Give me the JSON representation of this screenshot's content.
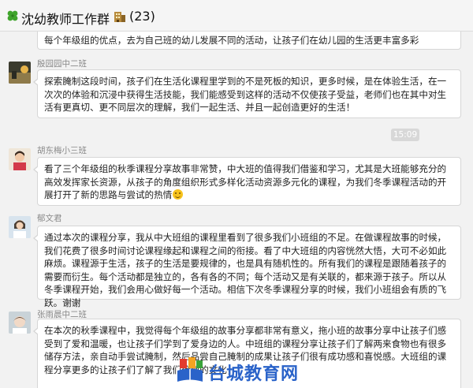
{
  "header": {
    "title": "沈幼教师工作群",
    "member_count": "(23)",
    "clover_icon": "four-leaf-clover-icon",
    "building_icon": "office-building-icon"
  },
  "messages": [
    {
      "sender": "",
      "text": "每个年级组的优点，去为自己班的幼儿发展不同的活动，让孩子们在幼儿园的生活更丰富多彩"
    },
    {
      "sender": "殷园园中二班",
      "text": "探索腌制这段时间，孩子们在生活化课程里学到的不是死板的知识，更多时候，是在体验生活，在一次次的体验和沉浸中获得生活技能，我们能感受到这样的活动不仅使孩子受益，老师们也在其中对生活有更真切、更不同层次的理解，我们一起生活、并且一起创造更好的生活！"
    },
    {
      "sender": "胡东梅小三班",
      "text": "看了三个年级组的秋季课程分享故事非常赞，中大班的值得我们借鉴和学习，尤其是大班能够充分的高效发挥家长资源，从孩子的角度组织形式多样化活动资源多元化的课程，为我们冬季课程活动的开展打开了新的思路与尝试的热情"
    },
    {
      "sender": "郁文君",
      "text": "通过本次的课程分享，我从中大班组的课程里看到了很多我们小班组的不足。在做课程故事的时候，我们花费了很多时间讨论课程缘起和课程之间的衔接。看了中大班组的内容恍然大悟，大可不必如此麻烦。课程源于生活，孩子的生活是要规律的，也是具有随机性的。所有我们的课程是跟随着孩子的需要而衍生。每个活动都是独立的，各有各的不同；每个活动又是有关联的，都来源于孩子。所以从冬季课程开始，我们会用心做好每一个活动。相信下次冬季课程分享的时候，我们小班组会有质的飞跃。谢谢"
    },
    {
      "sender": "张雨晨中二班",
      "text": "在本次的秋季课程中，我觉得每个年级组的故事分享都非常有意义，拖小班的故事分享中让孩子们感受到了爱和温暖，也让孩子们学到了爱身边的人。中班组的课程分享让孩子们了解两来食物也有很多储存方法，亲自动手尝试腌制，然后品尝自己腌制的成果让孩子们很有成功感和喜悦感。大班组的课程分享更多的让孩子们了解了我们徐州的文化，"
    }
  ],
  "timestamp": "15:09",
  "watermark": "台城教育网",
  "colors": {
    "header_bg": "#f5f5f5",
    "chat_bg": "#f2f2f2",
    "bubble_bg": "#ffffff",
    "bubble_border": "#d6d6d6",
    "sender_text": "#8a8a8a",
    "watermark_blue": "#2a63c9"
  }
}
